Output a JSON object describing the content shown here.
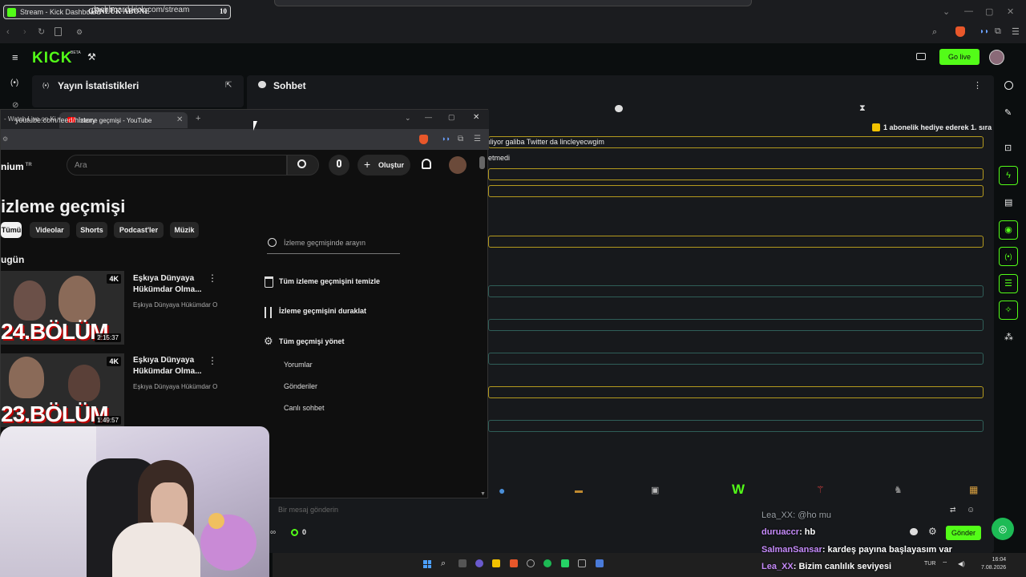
{
  "browser": {
    "tab_title": "Stream - Kick Dashboard",
    "overlay_label": "GÜNLÜK ABONE",
    "overlay_count": "10",
    "url": "dashboard.kick.com/stream"
  },
  "kick": {
    "logo": "KICK",
    "logo_badge": "BETA",
    "go_live_label": "Go live",
    "stats_title": "Yayın İstatistikleri",
    "chat_title": "Sohbet",
    "sub_gift_notice": "1 abonelik hediye ederek 1. sıra",
    "chat_messages": [
      "ıliyor galiba Twitter da lincleyecwgim",
      "etmedi"
    ],
    "chat_input_placeholder": "Bir mesaj gönderin",
    "viewer_count": "0",
    "send_label": "Gönder"
  },
  "overlay_chat": [
    {
      "user": "Lea_XX",
      "message": ": @ho mu",
      "user_color": "#9aa0a6"
    },
    {
      "user": "duruaccr",
      "message": ": hb",
      "user_color": "#c58af9"
    },
    {
      "user": "SalmanSansar",
      "message": ": kardeş payına başlayasım var",
      "user_color": "#c58af9"
    },
    {
      "user": "Lea_XX",
      "message": ": Bizim canlılık seviyesi",
      "user_color": "#c58af9"
    }
  ],
  "youtube": {
    "prev_tab": "- Watch Live on Ki",
    "tab_title": "İzleme geçmişi - YouTube",
    "url": "youtube.com/feed/history",
    "logo_text": "nium",
    "logo_sup": "TR",
    "search_placeholder": "Ara",
    "create_label": "Oluştur",
    "page_title": "izleme geçmişi",
    "chips": [
      "Tümü",
      "Videolar",
      "Shorts",
      "Podcast'ler",
      "Müzik"
    ],
    "section_today": "ugün",
    "videos": [
      {
        "title": "Eşkıya Dünyaya Hükümdar Olma...",
        "channel": "Eşkıya Dünyaya Hükümdar O",
        "episode": "24.BÖLÜM",
        "quality": "4K",
        "duration": "2:15:37"
      },
      {
        "title": "Eşkıya Dünyaya Hükümdar Olma...",
        "channel": "Eşkıya Dünyaya Hükümdar O",
        "episode": "23.BÖLÜM",
        "quality": "4K",
        "duration": "1:49:57"
      }
    ],
    "history_search_placeholder": "İzleme geçmişinde arayın",
    "actions": {
      "clear_all": "Tüm izleme geçmişini temizle",
      "pause": "İzleme geçmişini duraklat",
      "manage": "Tüm geçmişi yönet"
    },
    "sub_links": [
      "Yorumlar",
      "Gönderiler",
      "Canlı sohbet"
    ]
  },
  "taskbar": {
    "lang": "TUR",
    "time": "16:04",
    "date": "7.08.2026"
  },
  "colors": {
    "kick_green": "#53fc18",
    "chat_highlight": "#b49a1e",
    "youtube_red": "#ff0000"
  }
}
